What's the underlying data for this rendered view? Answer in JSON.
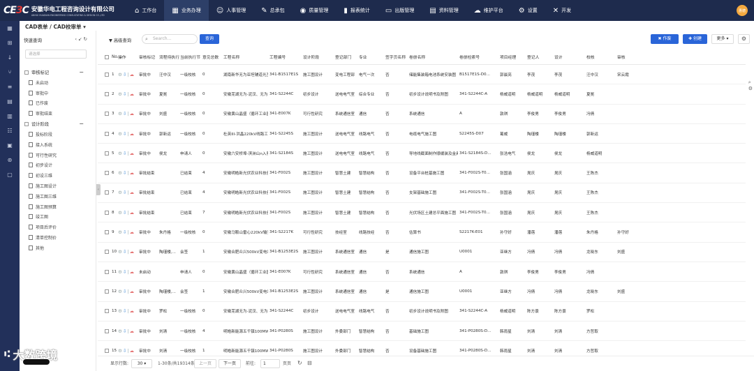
{
  "brand": {
    "mark_a": "CE",
    "mark_b": "3",
    "mark_c": "C",
    "name_cn": "安徽华电工程咨询设计有限公司",
    "name_en": "ANHUI HUADIAN ENGINEERING CONSULTATING & DESIGN CO.,LTD"
  },
  "nav": [
    {
      "icon": "⌂",
      "label": "工作台"
    },
    {
      "icon": "▦",
      "label": "业务办理"
    },
    {
      "icon": "☺",
      "label": "人事管理"
    },
    {
      "icon": "✎",
      "label": "总承包"
    },
    {
      "icon": "◉",
      "label": "质量管理"
    },
    {
      "icon": "▮",
      "label": "报表统计"
    },
    {
      "icon": "▭",
      "label": "出版管理"
    },
    {
      "icon": "▤",
      "label": "资料管理"
    },
    {
      "icon": "☁",
      "label": "维护平台"
    },
    {
      "icon": "⚙",
      "label": "设置"
    },
    {
      "icon": "✕",
      "label": "开发"
    }
  ],
  "user": {
    "avatar": "惠德"
  },
  "rail_icons": [
    "▦",
    "⊞",
    "↓",
    "⑂",
    "≡",
    "▤",
    "▥",
    "☷",
    "▣",
    "⊛",
    "▢"
  ],
  "page": {
    "title": "CAD表单 / CAD校审单",
    "dropdown": "▾"
  },
  "left_panel": {
    "title": "快速查询",
    "tools": "‹ ↙ ↻",
    "search_placeholder": "请选择",
    "groups": [
      {
        "label": "审核标记",
        "items": [
          "未启动",
          "审批中",
          "已作废",
          "审批结束"
        ]
      },
      {
        "label": "设计阶段",
        "items": [
          "投标阶段",
          "接入系统",
          "可行性研究",
          "初步设计",
          "初设三维",
          "施工图设计",
          "施工图三维",
          "施工图预算",
          "竣工图",
          "项目后评价",
          "清单控制价",
          "其他"
        ]
      }
    ]
  },
  "toolbar": {
    "filter": "▼ 高级查询",
    "search_placeholder": "Search...",
    "query": "查询",
    "void": "✖ 作废",
    "create": "✚ 创建",
    "more": "更多 ▾",
    "gear": "⚙"
  },
  "columns": [
    "No.",
    "操作",
    "审核标记",
    "流程待执行",
    "当前执行节",
    "意见总数",
    "工程名称",
    "工程编号",
    "设计阶段",
    "登记部门",
    "专业",
    "签字页名称",
    "卷册名称",
    "卷册检索号",
    "项目经理",
    "登记人",
    "设计",
    "校核",
    "审核"
  ],
  "rows": [
    {
      "no": "1",
      "mark": "审批中",
      "pending": "汪中汉",
      "node": "一级校核",
      "count": "0",
      "name": "湖南新华无为亚坦辅道光互补项目EPC总承包项目220kV...",
      "code": "341-B1517E1S",
      "stage": "施工图设计",
      "dept": "变电工程部",
      "major": "电气一次",
      "sig": "否",
      "vol": "储能集装箱电池系统安装图",
      "idx": "B1517E1S-D0...",
      "pm": "郭晨亮",
      "reg": "李茂",
      "design": "李茂",
      "check": "汪中汉",
      "audit": "宋云霞"
    },
    {
      "no": "2",
      "mark": "审批中",
      "pending": "夏冕",
      "node": "一级校核",
      "count": "0",
      "name": "安徽芜湖无为-泥汊、无为-日新T接港湾变电站110kV线...",
      "code": "341-S2244C",
      "stage": "初步设计",
      "dept": "送电电气室",
      "major": "综合专业",
      "sig": "否",
      "vol": "初步设计说明书及附图",
      "idx": "341-S2244C-A",
      "pm": "杨威道明",
      "reg": "杨威道明",
      "design": "杨威道明",
      "check": "夏冕",
      "audit": ""
    },
    {
      "no": "3",
      "mark": "审批中",
      "pending": "刘盛",
      "node": "一级校核",
      "count": "0",
      "name": "安徽黄山晶盛（循环工业园）110kV输变电工程",
      "code": "341-E007K",
      "stage": "可行性研究",
      "dept": "系统通信室",
      "major": "通信",
      "sig": "否",
      "vol": "系统通信",
      "idx": "A",
      "pm": "敦琪",
      "reg": "李俊男",
      "design": "李俊男",
      "check": "冯倩",
      "audit": ""
    },
    {
      "no": "4",
      "mark": "审批中",
      "pending": "郭新运",
      "node": "一级校核",
      "count": "0",
      "name": "杜英III-洪晶220kV线路工程",
      "code": "341-S2245S",
      "stage": "施工图设计",
      "dept": "送电电气室",
      "major": "线路电气",
      "sig": "否",
      "vol": "电缆电气施工图",
      "idx": "S2245S-D07",
      "pm": "葛威",
      "reg": "陶瑾楼",
      "design": "陶瑾楼",
      "check": "郭新运",
      "audit": ""
    },
    {
      "no": "5",
      "mark": "审批中",
      "pending": "侯龙",
      "node": "申请人",
      "count": "0",
      "name": "安徽六安桥埠-滨洲山n入黑鉴变电站110kV线路工程",
      "code": "341-S2184S",
      "stage": "施工图设计",
      "dept": "送电电气室",
      "major": "线路电气",
      "sig": "否",
      "vol": "导地线截面制作顺缓装及金具组...",
      "idx": "341-S2184S-D...",
      "pm": "张浩电气",
      "reg": "侯龙",
      "design": "侯龙",
      "check": "杨威道明",
      "audit": ""
    },
    {
      "no": "6",
      "mark": "审批结束",
      "pending": "",
      "node": "已结束",
      "count": "4",
      "name": "安徽明皓新光伏农业科技创新有限公司长丰县朱巷镇孝高...",
      "code": "341-F002S",
      "stage": "施工图设计",
      "dept": "智慧土建",
      "major": "智慧结构",
      "sig": "否",
      "vol": "设备平台桩基施工图",
      "idx": "341-F002S-T0...",
      "pm": "张国涵",
      "reg": "晁庆",
      "design": "晁庆",
      "check": "王陈杰",
      "audit": ""
    },
    {
      "no": "7",
      "mark": "审批结束",
      "pending": "",
      "node": "已结束",
      "count": "4",
      "name": "安徽明皓新光伏农业科技创新有限公司长丰县朱巷镇孝高...",
      "code": "341-F002S",
      "stage": "施工图设计",
      "dept": "智慧土建",
      "major": "智慧结构",
      "sig": "否",
      "vol": "支架基础施工图",
      "idx": "341-F002S-T0...",
      "pm": "张国涵",
      "reg": "晁庆",
      "design": "晁庆",
      "check": "王陈杰",
      "audit": ""
    },
    {
      "no": "8",
      "mark": "审批结束",
      "pending": "",
      "node": "已结束",
      "count": "7",
      "name": "安徽明皓新光伏农业科技创新有限公司长丰县朱巷镇孝高...",
      "code": "341-F002S",
      "stage": "施工图设计",
      "dept": "智慧土建",
      "major": "智慧结构",
      "sig": "否",
      "vol": "光伏场区土建总平面施工图",
      "idx": "341-F002S-T0...",
      "pm": "张国涵",
      "reg": "晁庆",
      "design": "晁庆",
      "check": "王陈杰",
      "audit": ""
    },
    {
      "no": "9",
      "mark": "审批中",
      "pending": "朱丹格",
      "node": "一级校核",
      "count": "0",
      "name": "安徽马鞍山雷心220kV输变电工程",
      "code": "341-S2217K",
      "stage": "可行性研究",
      "dept": "技经室",
      "major": "线路技经",
      "sig": "否",
      "vol": "估算书",
      "idx": "S2217K-E01",
      "pm": "孙守好",
      "reg": "潘蓓",
      "design": "潘蓓",
      "check": "朱丹格",
      "audit": "孙守好"
    },
    {
      "no": "10",
      "mark": "审批中",
      "pending": "陶瑾楼,...",
      "node": "会签",
      "count": "1",
      "name": "安徽合肥众兴500kV变电站220kV配套至引出间隔扩建...",
      "code": "341-B1253E2S",
      "stage": "施工图设计",
      "dept": "系统通信室",
      "major": "通信",
      "sig": "是",
      "vol": "通信施工图",
      "idx": "U0001",
      "pm": "亚继方",
      "reg": "冯倩",
      "design": "冯倩",
      "check": "龙晓东",
      "audit": "刘盛"
    },
    {
      "no": "11",
      "mark": "未启动",
      "pending": "",
      "node": "申请人",
      "count": "0",
      "name": "安徽黄山晶盛（循环工业园）110kV输变电工程",
      "code": "341-E007K",
      "stage": "可行性研究",
      "dept": "系统通信室",
      "major": "通信",
      "sig": "否",
      "vol": "系统通信",
      "idx": "A",
      "pm": "敦琪",
      "reg": "李俊男",
      "design": "李俊男",
      "check": "冯倩",
      "audit": ""
    },
    {
      "no": "12",
      "mark": "审批中",
      "pending": "陶瑾楼,...",
      "node": "会签",
      "count": "1",
      "name": "安徽合肥众兴500kV变电站220kV配套至引出间隔扩建...",
      "code": "341-B1253E2S",
      "stage": "施工图设计",
      "dept": "系统通信室",
      "major": "通信",
      "sig": "是",
      "vol": "通信施工图",
      "idx": "U0001",
      "pm": "亚继方",
      "reg": "冯倩",
      "design": "冯倩",
      "check": "龙晓东",
      "audit": "刘盛"
    },
    {
      "no": "13",
      "mark": "审批中",
      "pending": "罗松",
      "node": "一级校核",
      "count": "0",
      "name": "安徽芜湖无为-泥汊、无为-日新T接港湾变电站110kV线...",
      "code": "341-S2244C",
      "stage": "初步设计",
      "dept": "送电电气室",
      "major": "线路电气",
      "sig": "否",
      "vol": "初步设计说明书及附图",
      "idx": "341-S2244C-A",
      "pm": "杨威道明",
      "reg": "陈方景",
      "design": "陈方景",
      "check": "罗松",
      "audit": ""
    },
    {
      "no": "14",
      "mark": "审批中",
      "pending": "刘清",
      "node": "一级校核",
      "count": "4",
      "name": "明皓新能源五千镇100MW光伏电站光伏场区工程",
      "code": "341-P0280S",
      "stage": "施工图设计",
      "dept": "外委部门",
      "major": "智慧结构",
      "sig": "否",
      "vol": "基础施工图",
      "idx": "341-P0280S-D...",
      "pm": "韩雨星",
      "reg": "刘清",
      "design": "刘清",
      "check": "方哲取",
      "audit": ""
    },
    {
      "no": "15",
      "mark": "审批中",
      "pending": "刘清",
      "node": "一级校核",
      "count": "1",
      "name": "明皓新能源五千镇100MW光伏电站光伏场区工程",
      "code": "341-P0280S",
      "stage": "施工图设计",
      "dept": "外委部门",
      "major": "智慧结构",
      "sig": "否",
      "vol": "设备基础施工图",
      "idx": "341-P0280S-D...",
      "pm": "韩雨星",
      "reg": "刘清",
      "design": "刘清",
      "check": "方哲取",
      "audit": ""
    }
  ],
  "footer": {
    "page_size_label": "显示行数:",
    "page_size": "30 ▾",
    "range": "1-30条/共19314条",
    "prev": "上一页",
    "next": "下一页",
    "goto_label": "前往:",
    "goto_value": "1",
    "page_unit": "页页",
    "refresh": "↻",
    "export": "⊟"
  },
  "watermark": {
    "icon": "⑆",
    "text": "大数跨境"
  }
}
